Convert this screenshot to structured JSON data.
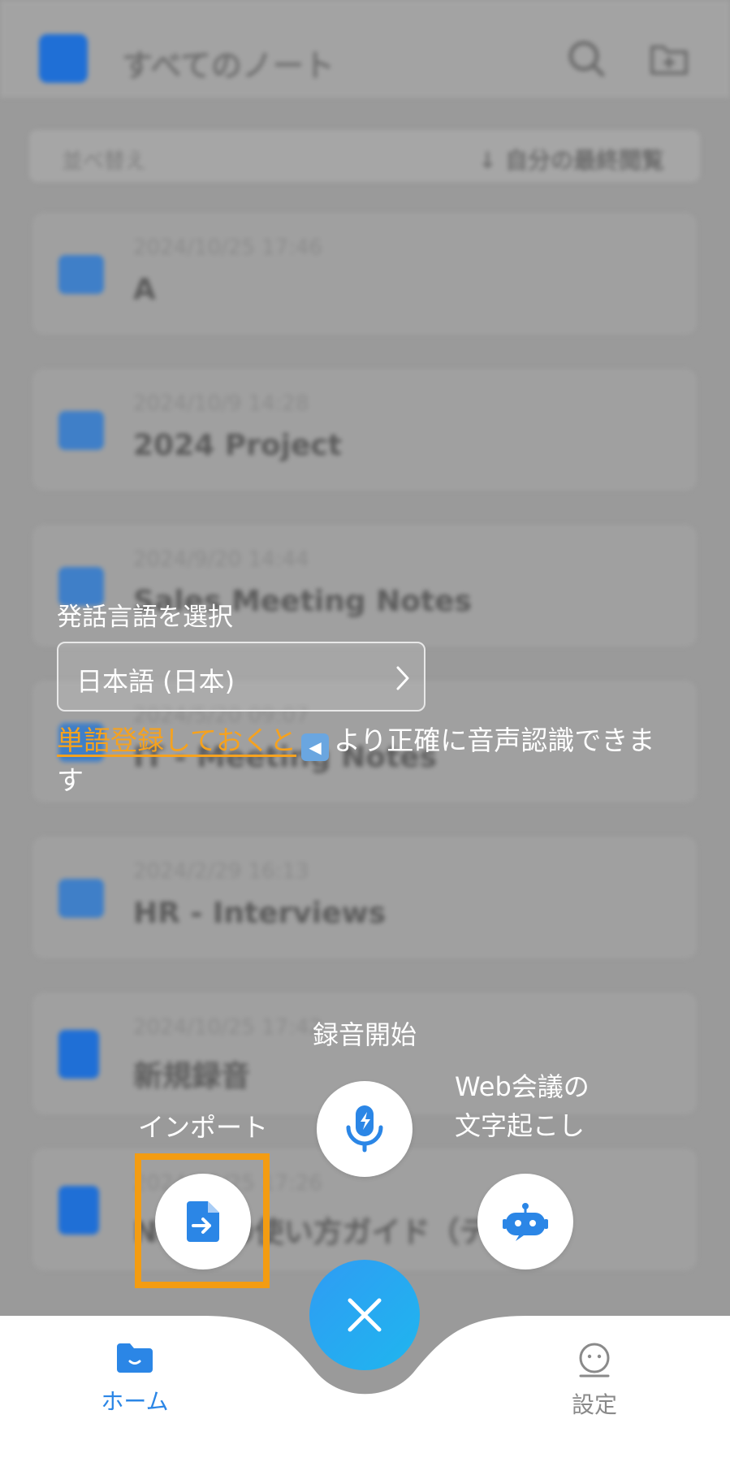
{
  "background": {
    "title": "すべてのノート",
    "sort_label": "並べ替え",
    "sort_order": "↓ 自分の最終閲覧",
    "notes": [
      {
        "date": "2024/10/25  17:46",
        "title": "A",
        "kind": "folder"
      },
      {
        "date": "2024/10/9  14:28",
        "title": "2024 Project",
        "kind": "folder"
      },
      {
        "date": "2024/9/20  14:44",
        "title": "Sales Meeting Notes",
        "kind": "folder"
      },
      {
        "date": "2024/5/20  09:07",
        "title": "IT - Meeting Notes",
        "kind": "folder"
      },
      {
        "date": "2024/2/29  16:13",
        "title": "HR - Interviews",
        "kind": "folder"
      },
      {
        "date": "2024/10/25  17:42",
        "title": "新規録音",
        "kind": "recording"
      },
      {
        "date": "2024/10/25  17:26",
        "title": "Nottaの使い方ガイド（テスト）",
        "kind": "guide"
      }
    ]
  },
  "language": {
    "label": "発話言語を選択",
    "value": "日本語 (日本)"
  },
  "hint": {
    "link": "単語登録しておくと",
    "emoji": "◀",
    "rest": "より正確に音声認識できます"
  },
  "actions": {
    "record_label": "録音開始",
    "import_label": "インポート",
    "web_label_line1": "Web会議の",
    "web_label_line2": "文字起こし"
  },
  "nav": {
    "home_label": "ホーム",
    "settings_label": "設定"
  },
  "colors": {
    "accent": "#2b86e6",
    "highlight": "#f39c12",
    "link": "#f6a21e"
  }
}
